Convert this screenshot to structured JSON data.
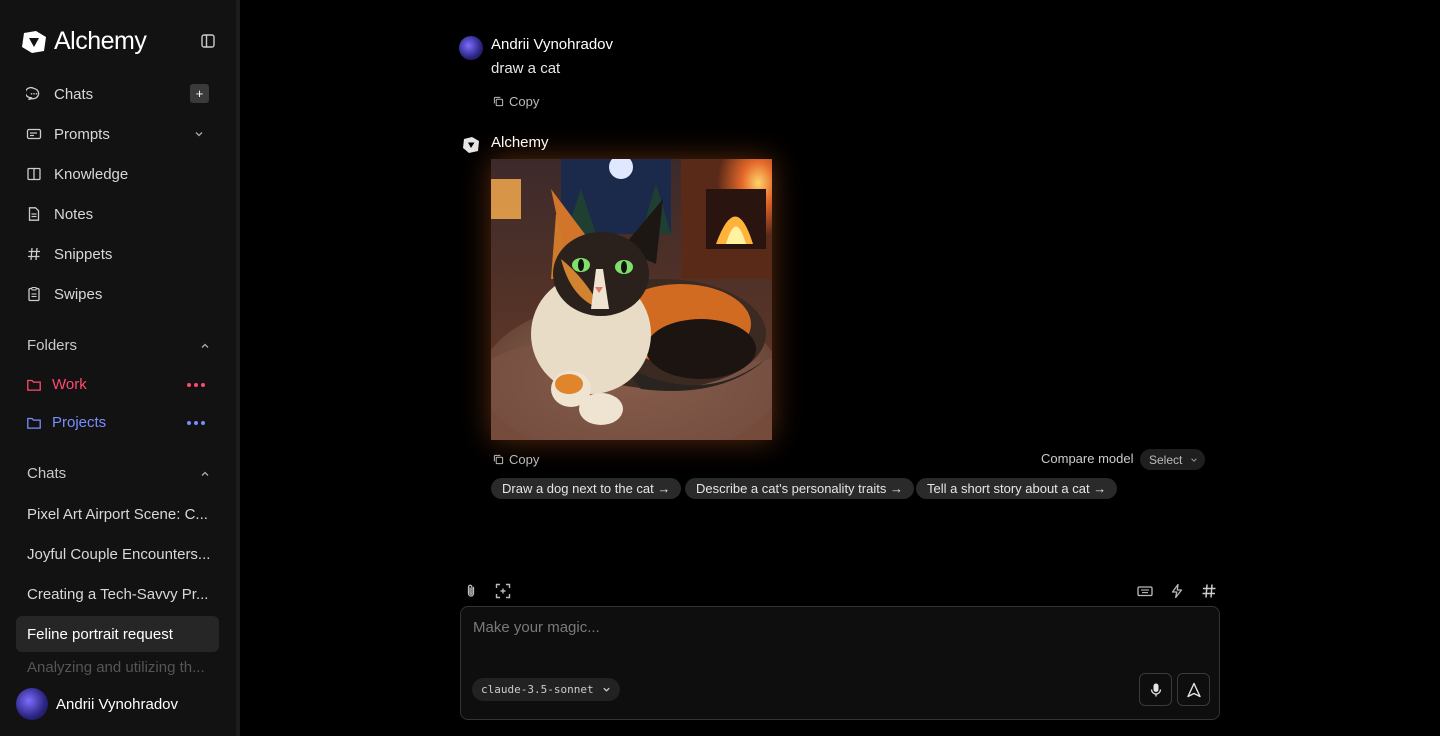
{
  "app": {
    "name": "Alchemy"
  },
  "sidebar": {
    "nav": [
      {
        "label": "Chats",
        "icon": "chat-bubble-icon"
      },
      {
        "label": "Prompts",
        "icon": "prompt-card-icon"
      },
      {
        "label": "Knowledge",
        "icon": "book-icon"
      },
      {
        "label": "Notes",
        "icon": "note-icon"
      },
      {
        "label": "Snippets",
        "icon": "hash-icon"
      },
      {
        "label": "Swipes",
        "icon": "clipboard-icon"
      }
    ],
    "new_chat_symbol": "+",
    "folders_header": "Folders",
    "folders": [
      {
        "label": "Work",
        "color": "#ff4a6e"
      },
      {
        "label": "Projects",
        "color": "#7b8cff"
      }
    ],
    "chats_header": "Chats",
    "chats": [
      "Pixel Art Airport Scene: C...",
      "Joyful Couple Encounters...",
      "Creating a Tech-Savvy Pr...",
      "Feline portrait request",
      "Analyzing and utilizing th..."
    ],
    "user_name": "Andrii Vynohradov"
  },
  "conversation": {
    "user_name": "Andrii Vynohradov",
    "user_message": "draw a cat",
    "copy_label": "Copy",
    "assistant_name": "Alchemy",
    "compare_label": "Compare model",
    "select_label": "Select",
    "suggestions": [
      "Draw a dog next to the cat →",
      "Describe a cat's personality traits →",
      "Tell a short story about a cat →"
    ]
  },
  "composer": {
    "placeholder": "Make your magic...",
    "model": "claude-3.5-sonnet"
  },
  "colors": {
    "accent_work": "#ff4a6e",
    "accent_projects": "#7b8cff",
    "background": "#000000",
    "sidebar": "#121212"
  }
}
